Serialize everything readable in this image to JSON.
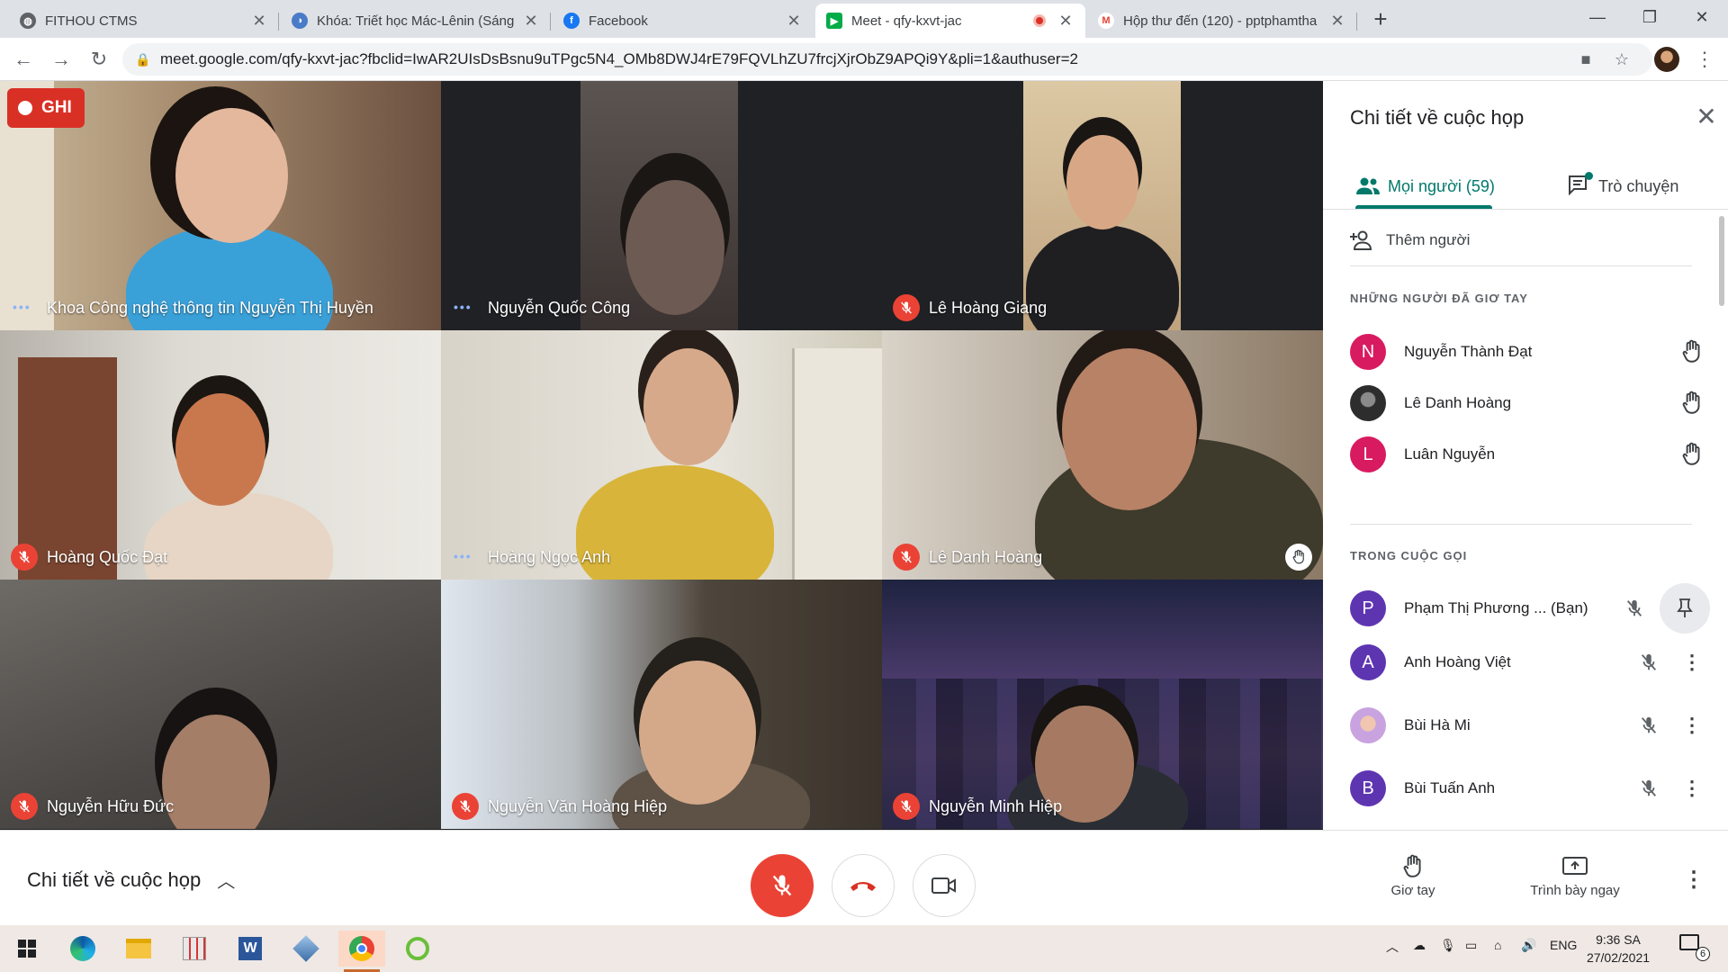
{
  "browser": {
    "tabs": [
      {
        "title": "FITHOU CTMS",
        "icon": "globe-icon"
      },
      {
        "title": "Khóa: Triết học Mác-Lênin (Sáng",
        "icon": "moodle-icon"
      },
      {
        "title": "Facebook",
        "icon": "facebook-icon"
      },
      {
        "title": "Meet - qfy-kxvt-jac",
        "icon": "meet-icon",
        "active": true,
        "recording": true
      },
      {
        "title": "Hộp thư đến (120) - pptphamtha",
        "icon": "gmail-icon"
      }
    ],
    "url": "meet.google.com/qfy-kxvt-jac?fbclid=IwAR2UIsDsBsnu9uTPgc5N4_OMb8DWJ4rE79FQVLhZU7frcjXjrObZ9APQi9Y&pli=1&authuser=2"
  },
  "recording": {
    "label": "GHI"
  },
  "tiles": [
    {
      "name": "Khoa Công nghệ thông tin Nguyễn Thị Huyền",
      "status": "speaking"
    },
    {
      "name": "Nguyễn Quốc Công",
      "status": "speaking"
    },
    {
      "name": "Lê Hoàng Giang",
      "status": "muted"
    },
    {
      "name": "Hoàng Quốc Đạt",
      "status": "muted"
    },
    {
      "name": "Hoàng Ngọc Anh",
      "status": "speaking"
    },
    {
      "name": "Lê Danh Hoàng",
      "status": "muted",
      "hand_raised": true
    },
    {
      "name": "Nguyễn Hữu Đức",
      "status": "muted"
    },
    {
      "name": "Nguyễn Văn Hoàng Hiệp",
      "status": "muted"
    },
    {
      "name": "Nguyễn Minh Hiệp",
      "status": "muted"
    }
  ],
  "panel": {
    "title": "Chi tiết về cuộc họp",
    "tab_people": "Mọi người (59)",
    "tab_chat": "Trò chuyện",
    "add_people": "Thêm người",
    "raised_hands_header": "NHỮNG NGƯỜI ĐÃ GIƠ TAY",
    "raised_hands": [
      {
        "initial": "N",
        "name": "Nguyễn Thành Đạt",
        "color": "#d81b60"
      },
      {
        "initial": "",
        "name": "Lê Danh Hoàng",
        "color": "#2d2d2d"
      },
      {
        "initial": "L",
        "name": "Luân Nguyễn",
        "color": "#d81b60"
      }
    ],
    "in_call_header": "TRONG CUỘC GỌI",
    "in_call": [
      {
        "initial": "P",
        "name": "Phạm Thị Phương ... (Bạn)",
        "color": "#5e35b1"
      },
      {
        "initial": "A",
        "name": "Anh Hoàng Việt",
        "color": "#5e35b1"
      },
      {
        "initial": "",
        "name": "Bùi Hà Mi",
        "color": "#c9a3e0"
      },
      {
        "initial": "B",
        "name": "Bùi Tuấn Anh",
        "color": "#5e35b1"
      }
    ]
  },
  "controls": {
    "details_label": "Chi tiết về cuộc họp",
    "raise_hand_label": "Giơ tay",
    "present_label": "Trình bày ngay"
  },
  "taskbar": {
    "lang": "ENG",
    "time": "9:36 SA",
    "date": "27/02/2021",
    "notifications": "6"
  },
  "colors": {
    "accent": "#00796b",
    "danger": "#ea4335",
    "grid_bg": "#202124"
  }
}
